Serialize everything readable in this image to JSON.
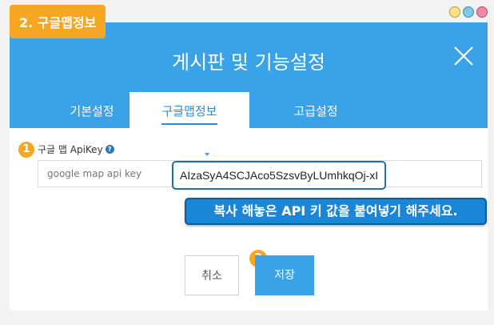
{
  "step_badge": "2. 구글맵정보",
  "window": {
    "dot_colors": [
      "#fbe38a",
      "#7ec8e3",
      "#f08aab"
    ]
  },
  "modal": {
    "title": "게시판 및 기능설정",
    "close_icon": "close-x-icon",
    "header_color": "#3aa3e8"
  },
  "tabs": [
    {
      "label": "기본설정",
      "active": false
    },
    {
      "label": "구글맵정보",
      "active": true
    },
    {
      "label": "고급설정",
      "active": false
    }
  ],
  "field": {
    "step": "1",
    "label": "구글 맵 ApiKey",
    "help_icon": "question-circle-icon",
    "placeholder": "google map api key",
    "value": "AIzaSyA4SCJAco5SzsvByLUmhkqOj-xI"
  },
  "tooltip": "복사 해놓은 API 키 값을 붙여넣기 해주세요.",
  "buttons": {
    "step": "2",
    "cancel": "취소",
    "save": "저장"
  }
}
